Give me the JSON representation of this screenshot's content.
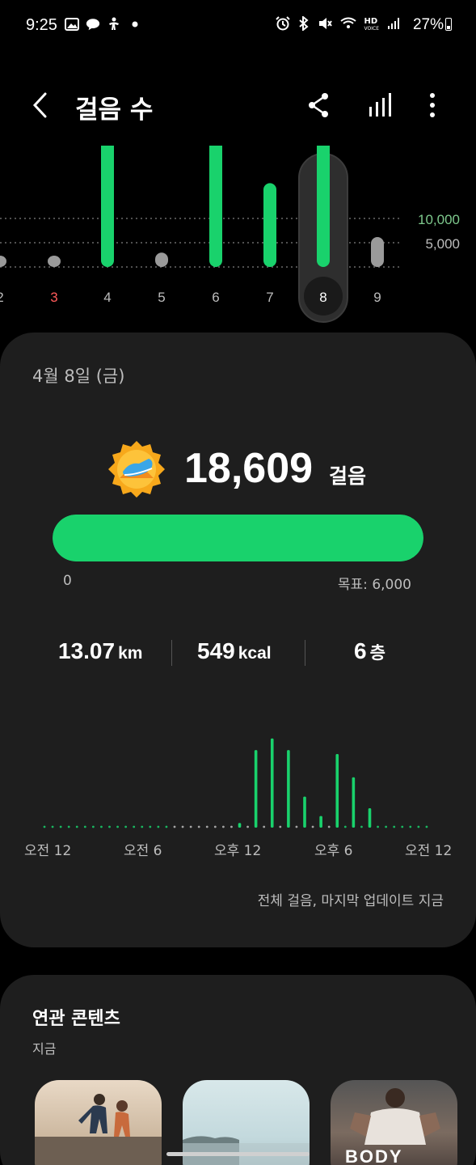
{
  "status_bar": {
    "time": "9:25",
    "battery": "27%",
    "left_icons": [
      "image-icon",
      "talk-icon",
      "accessibility-icon",
      "dot-icon"
    ],
    "right_icons": [
      "alarm-icon",
      "bluetooth-icon",
      "mute-icon",
      "wifi-icon",
      "hd-voice-icon",
      "signal-icon"
    ],
    "hd_label": "HD",
    "voice_label": "VOICE"
  },
  "appbar": {
    "title": "걸음 수"
  },
  "week_chart": {
    "ref_high": "10,000",
    "ref_low": "5,000",
    "days": [
      {
        "label": "2",
        "steps": 0,
        "color": "#bdbdbd"
      },
      {
        "label": "3",
        "steps": 0,
        "color": "#ff5a5a"
      },
      {
        "label": "4",
        "steps": 11000,
        "color": "#bdbdbd"
      },
      {
        "label": "5",
        "steps": 1200,
        "color": "#bdbdbd"
      },
      {
        "label": "6",
        "steps": 11500,
        "color": "#bdbdbd"
      },
      {
        "label": "7",
        "steps": 7000,
        "color": "#bdbdbd"
      },
      {
        "label": "8",
        "steps": 18609,
        "color": "#ffffff",
        "selected": true
      },
      {
        "label": "9",
        "steps": 2500,
        "color": "#bdbdbd"
      }
    ],
    "goal": 6000
  },
  "summary": {
    "date": "4월 8일 (금)",
    "steps": "18,609",
    "steps_unit": "걸음",
    "progress_fraction": 1.0,
    "progress_min": "0",
    "progress_goal": "목표: 6,000",
    "distance": "13.07",
    "distance_unit": "km",
    "calories": "549",
    "calories_unit": "kcal",
    "floors": "6",
    "floors_unit": "층",
    "hour_labels": [
      "오전 12",
      "오전 6",
      "오후 12",
      "오후 6",
      "오전 12"
    ],
    "note": "전체 걸음, 마지막 업데이트 지금"
  },
  "chart_data": {
    "type": "bar",
    "x": [
      0,
      0.5,
      1,
      1.5,
      2,
      2.5,
      3,
      3.5,
      4,
      4.5,
      5,
      5.5,
      6,
      6.5,
      7,
      7.5,
      8,
      8.5,
      9,
      9.5,
      10,
      10.5,
      11,
      11.5,
      12,
      12.5,
      13,
      13.5,
      14,
      14.5,
      15,
      15.5,
      16,
      16.5,
      17,
      17.5,
      18,
      18.5,
      19,
      19.5,
      20,
      20.5,
      21,
      21.5,
      22,
      22.5,
      23,
      23.5
    ],
    "values": [
      0,
      0,
      0,
      0,
      0,
      0,
      0,
      0,
      0,
      0,
      0,
      0,
      0,
      0,
      0,
      0,
      0,
      0,
      0,
      0,
      0,
      0,
      0,
      0,
      60,
      0,
      1000,
      0,
      1150,
      0,
      1000,
      0,
      400,
      0,
      150,
      0,
      950,
      0,
      650,
      0,
      250,
      0,
      0,
      0,
      0,
      0,
      0,
      0
    ],
    "xlabel": "",
    "ylabel": ""
  },
  "related": {
    "title": "연관 콘텐츠",
    "subtitle": "지금",
    "cards": [
      {
        "name": "running-couple-thumbnail"
      },
      {
        "name": "seaside-thumbnail"
      },
      {
        "name": "body-blast-thumbnail",
        "label": "BODY BLAST"
      }
    ]
  },
  "colors": {
    "accent": "#19d26c",
    "card": "#1e1e1e",
    "background": "#000000",
    "muted": "#bdbdbd"
  }
}
